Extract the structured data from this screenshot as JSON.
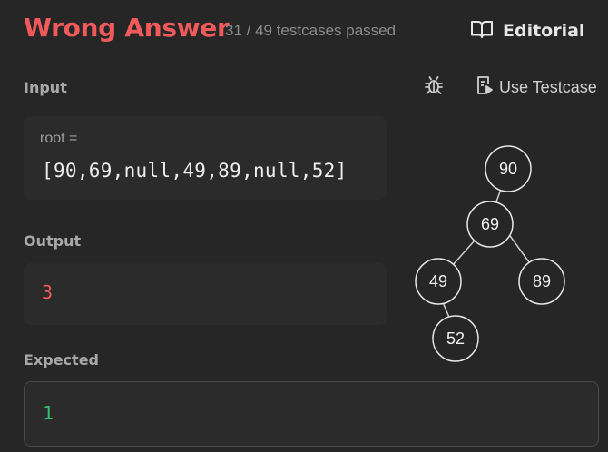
{
  "header": {
    "status": "Wrong Answer",
    "testcases": "31 / 49 testcases passed",
    "editorial_label": "Editorial"
  },
  "toolbar": {
    "debug_icon": "bug-icon",
    "use_testcase_label": "Use Testcase",
    "use_testcase_icon": "testcase-icon"
  },
  "input": {
    "label": "Input",
    "var_name": "root =",
    "value": "[90,69,null,49,89,null,52]"
  },
  "output": {
    "label": "Output",
    "value": "3"
  },
  "expected": {
    "label": "Expected",
    "value": "1"
  },
  "tree": {
    "nodes": [
      "90",
      "69",
      "49",
      "89",
      "52"
    ]
  },
  "colors": {
    "error": "#f05a5a",
    "success": "#35c26b",
    "background": "#262626",
    "panel": "#2b2b2b"
  }
}
